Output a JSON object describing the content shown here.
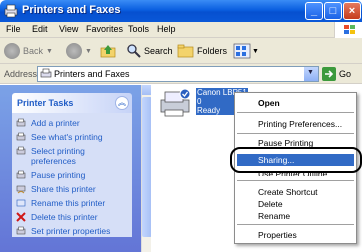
{
  "window": {
    "title": "Printers and Faxes",
    "min_label": "_",
    "max_label": "□",
    "close_label": "×"
  },
  "menu": {
    "items": [
      "File",
      "Edit",
      "View",
      "Favorites",
      "Tools",
      "Help"
    ]
  },
  "toolbar": {
    "back_label": "Back",
    "search_label": "Search",
    "folders_label": "Folders"
  },
  "address": {
    "label": "Address",
    "value": "Printers and Faxes",
    "go_label": "Go"
  },
  "tasks": {
    "title": "Printer Tasks",
    "items": [
      {
        "label": "Add a printer",
        "icon": "add-printer-icon"
      },
      {
        "label": "See what's printing",
        "icon": "printer-queue-icon"
      },
      {
        "label": "Select printing",
        "icon": "printer-prefs-icon"
      },
      {
        "label": "preferences",
        "icon": ""
      },
      {
        "label": "Pause printing",
        "icon": "pause-printer-icon"
      },
      {
        "label": "Share this printer",
        "icon": "share-printer-icon"
      },
      {
        "label": "Rename this printer",
        "icon": "rename-icon"
      },
      {
        "label": "Delete this printer",
        "icon": "delete-icon"
      },
      {
        "label": "Set printer properties",
        "icon": "properties-icon"
      }
    ]
  },
  "printer": {
    "name_line1": "Canon LBP5100",
    "docs": "0",
    "status": "Ready"
  },
  "context_menu": {
    "open": "Open",
    "printing_prefs": "Printing Preferences...",
    "pause": "Pause Printing",
    "sharing": "Sharing...",
    "use_offline": "Use Printer Offline",
    "create_shortcut": "Create Shortcut",
    "delete": "Delete",
    "rename": "Rename",
    "properties": "Properties"
  },
  "colors": {
    "title_bar": "#0a5fe0",
    "task_link": "#215dc6",
    "selection": "#316ac5"
  }
}
